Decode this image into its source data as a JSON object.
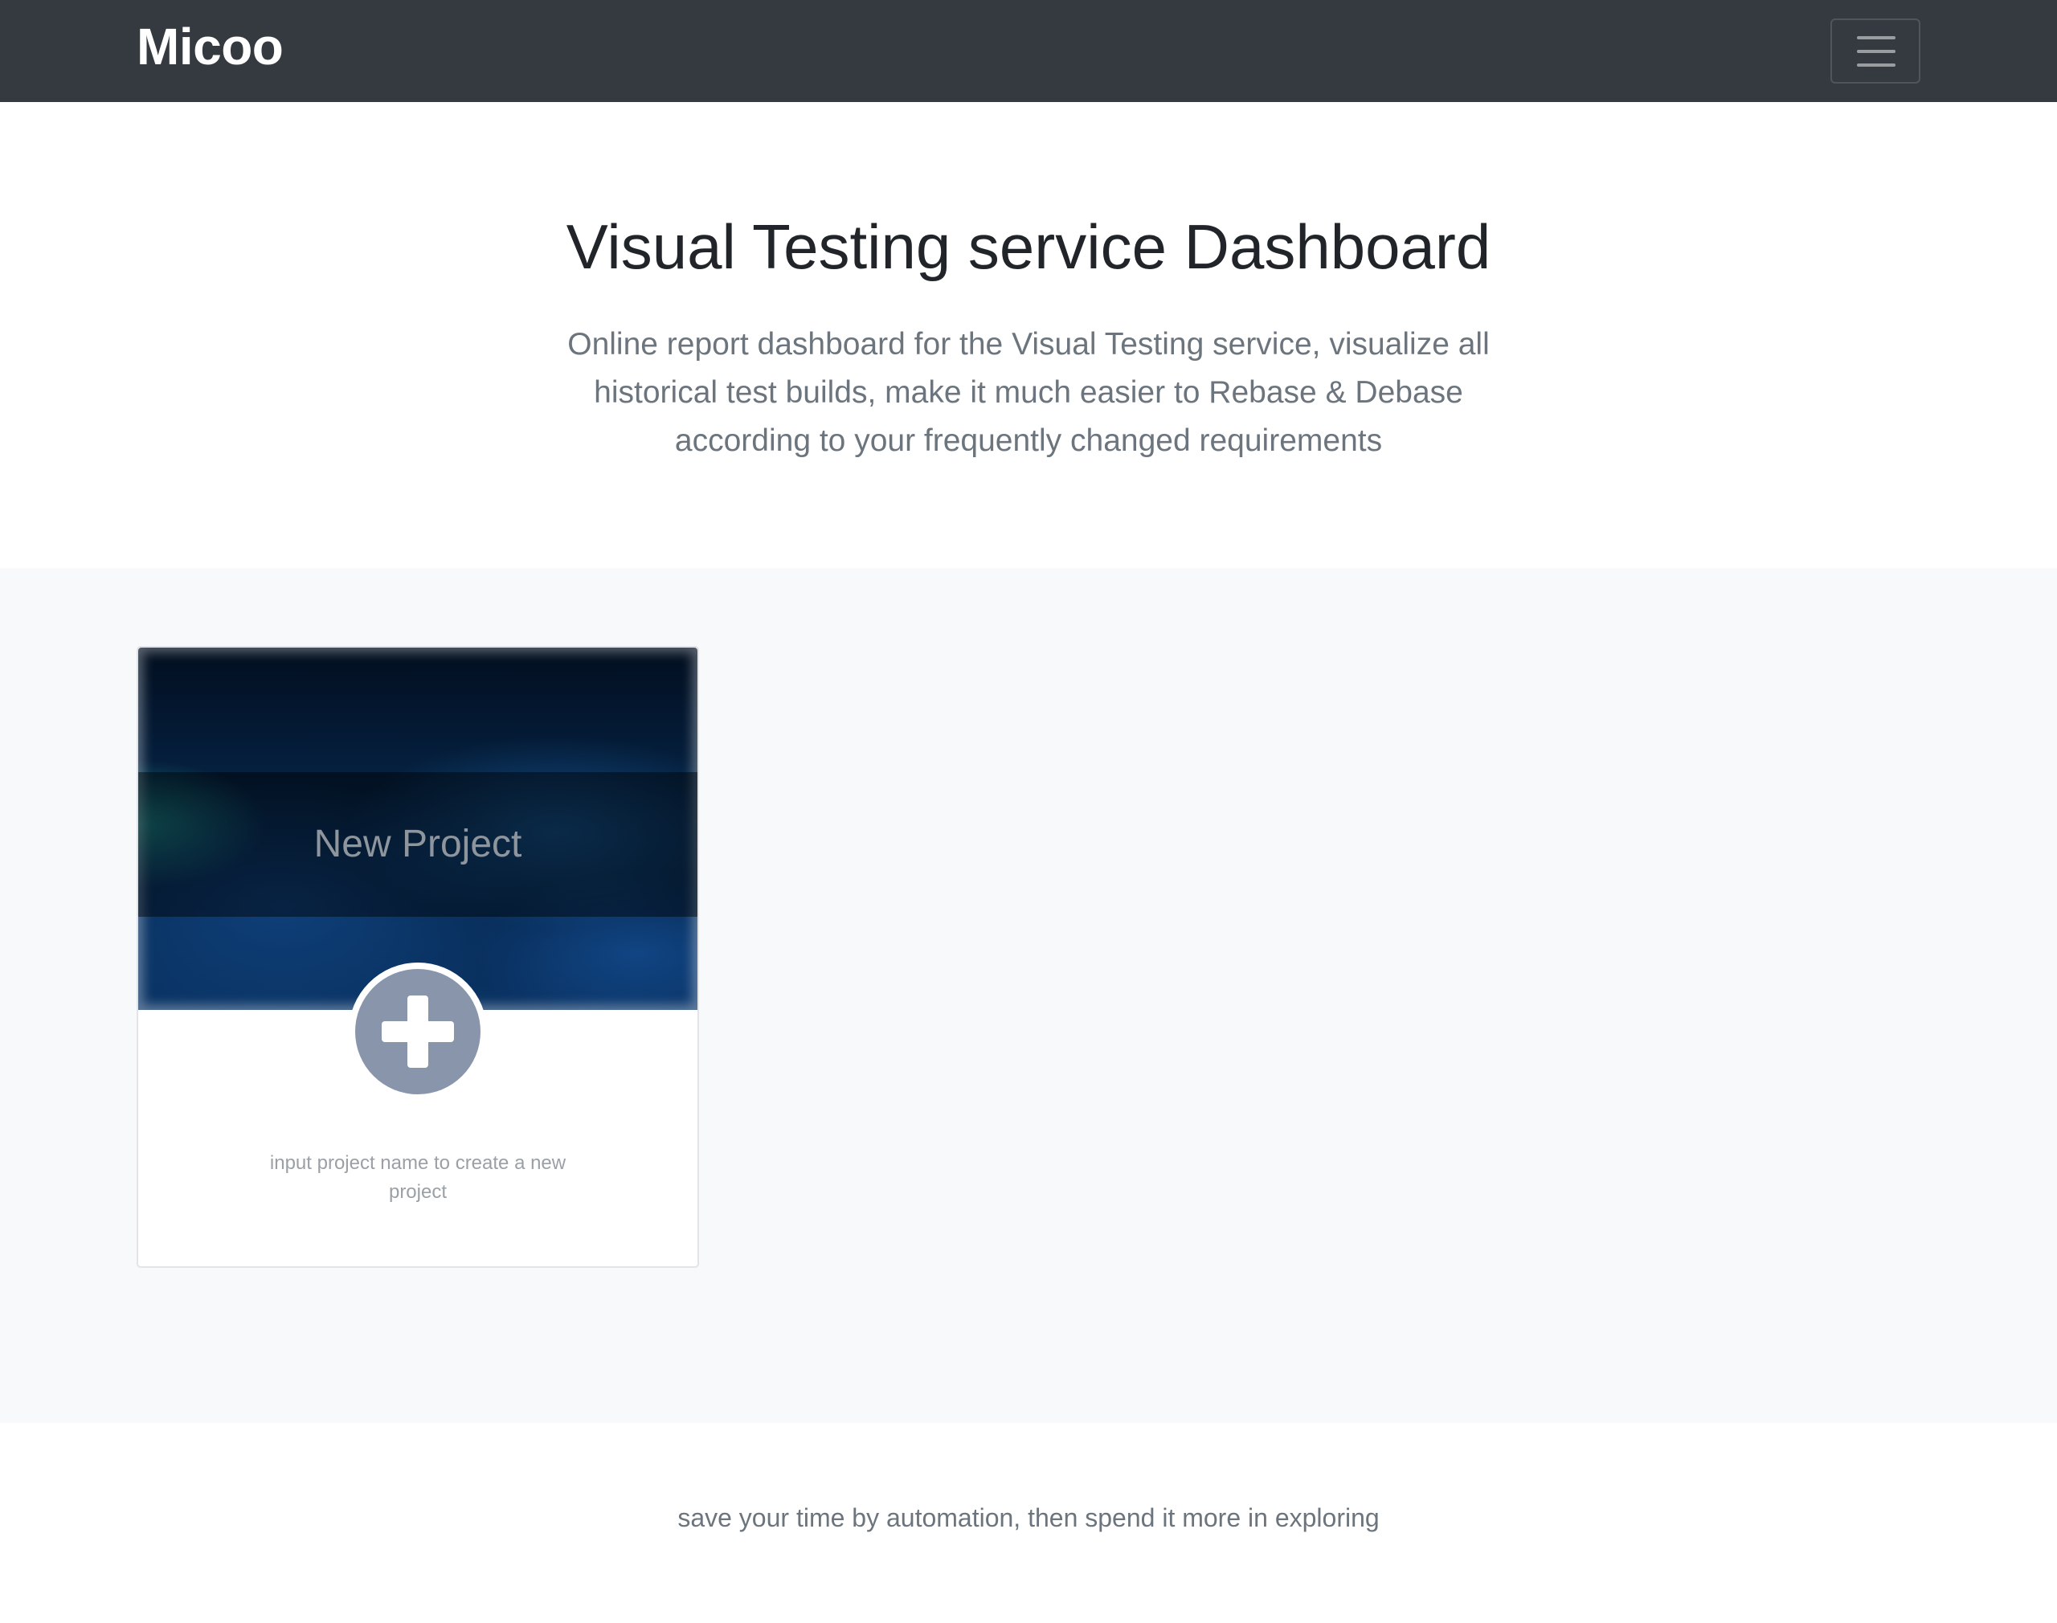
{
  "navbar": {
    "brand": "Micoo",
    "toggler_icon": "hamburger-menu-icon"
  },
  "hero": {
    "title": "Visual Testing service Dashboard",
    "lead": "Online report dashboard for the Visual Testing service, visualize all historical test builds, make it much easier to Rebase & Debase according to your frequently changed requirements"
  },
  "new_project_card": {
    "title": "New Project",
    "add_icon": "plus-circle-icon",
    "hint": "input project name to create a new project"
  },
  "footer": {
    "text": "save your time by automation, then spend it more in exploring"
  },
  "colors": {
    "navbar_bg": "#343a40",
    "album_bg": "#f8f9fa",
    "add_button": "#8895ab"
  }
}
